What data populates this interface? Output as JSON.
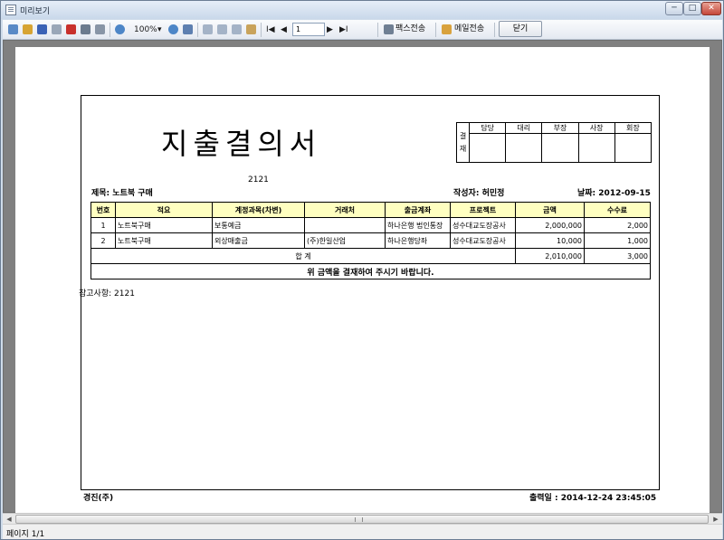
{
  "window": {
    "title": "미리보기",
    "min_label": "─",
    "max_label": "□",
    "close_label": "✕"
  },
  "toolbar": {
    "zoom": "100%",
    "zoom_dropdown": "▾",
    "page_value": "1",
    "nav_first": "I◀",
    "nav_prev": "◀",
    "nav_next": "▶",
    "nav_last": "▶I",
    "fax_label": "팩스전송",
    "mail_label": "메일전송",
    "close_label": "닫기",
    "icon_colors": {
      "print": "#5a8ac6",
      "open": "#d7a433",
      "save": "#3b62b5",
      "pdf": "#c8302b",
      "find": "#6b7b8e",
      "zoom": "#4d86c7"
    }
  },
  "document": {
    "title": "지출결의서",
    "approval": {
      "side_label_top": "결",
      "side_label_bottom": "재",
      "headers": [
        "담당",
        "대리",
        "부장",
        "사장",
        "회장"
      ]
    },
    "top_code": "2121",
    "subject_label": "제목: 노트북 구매",
    "writer_label": "작성자: 허민정",
    "date_label": "날짜: 2012-09-15",
    "columns": [
      "번호",
      "적요",
      "계정과목(차변)",
      "거래처",
      "출금계좌",
      "프로젝트",
      "금액",
      "수수료"
    ],
    "rows": [
      {
        "no": "1",
        "summary": "노트북구매",
        "account": "보통예금",
        "vendor": "",
        "bank": "하나은행 법인통장",
        "project": "성수대교도장공사",
        "amount": "2,000,000",
        "fee": "2,000"
      },
      {
        "no": "2",
        "summary": "노트북구매",
        "account": "외상매출금",
        "vendor": "(주)한일산업",
        "bank": "하나은행당좌",
        "project": "성수대교도장공사",
        "amount": "10,000",
        "fee": "1,000"
      }
    ],
    "total_label": "합  계",
    "total_amount": "2,010,000",
    "total_fee": "3,000",
    "notice": "위 금액을 결재하여 주시기 바랍니다.",
    "reference": "참고사항: 2121",
    "company": "경진(주)",
    "print_label": "출력일 : 2014-12-24    23:45:05"
  },
  "status": {
    "page": "페이지 1/1"
  }
}
